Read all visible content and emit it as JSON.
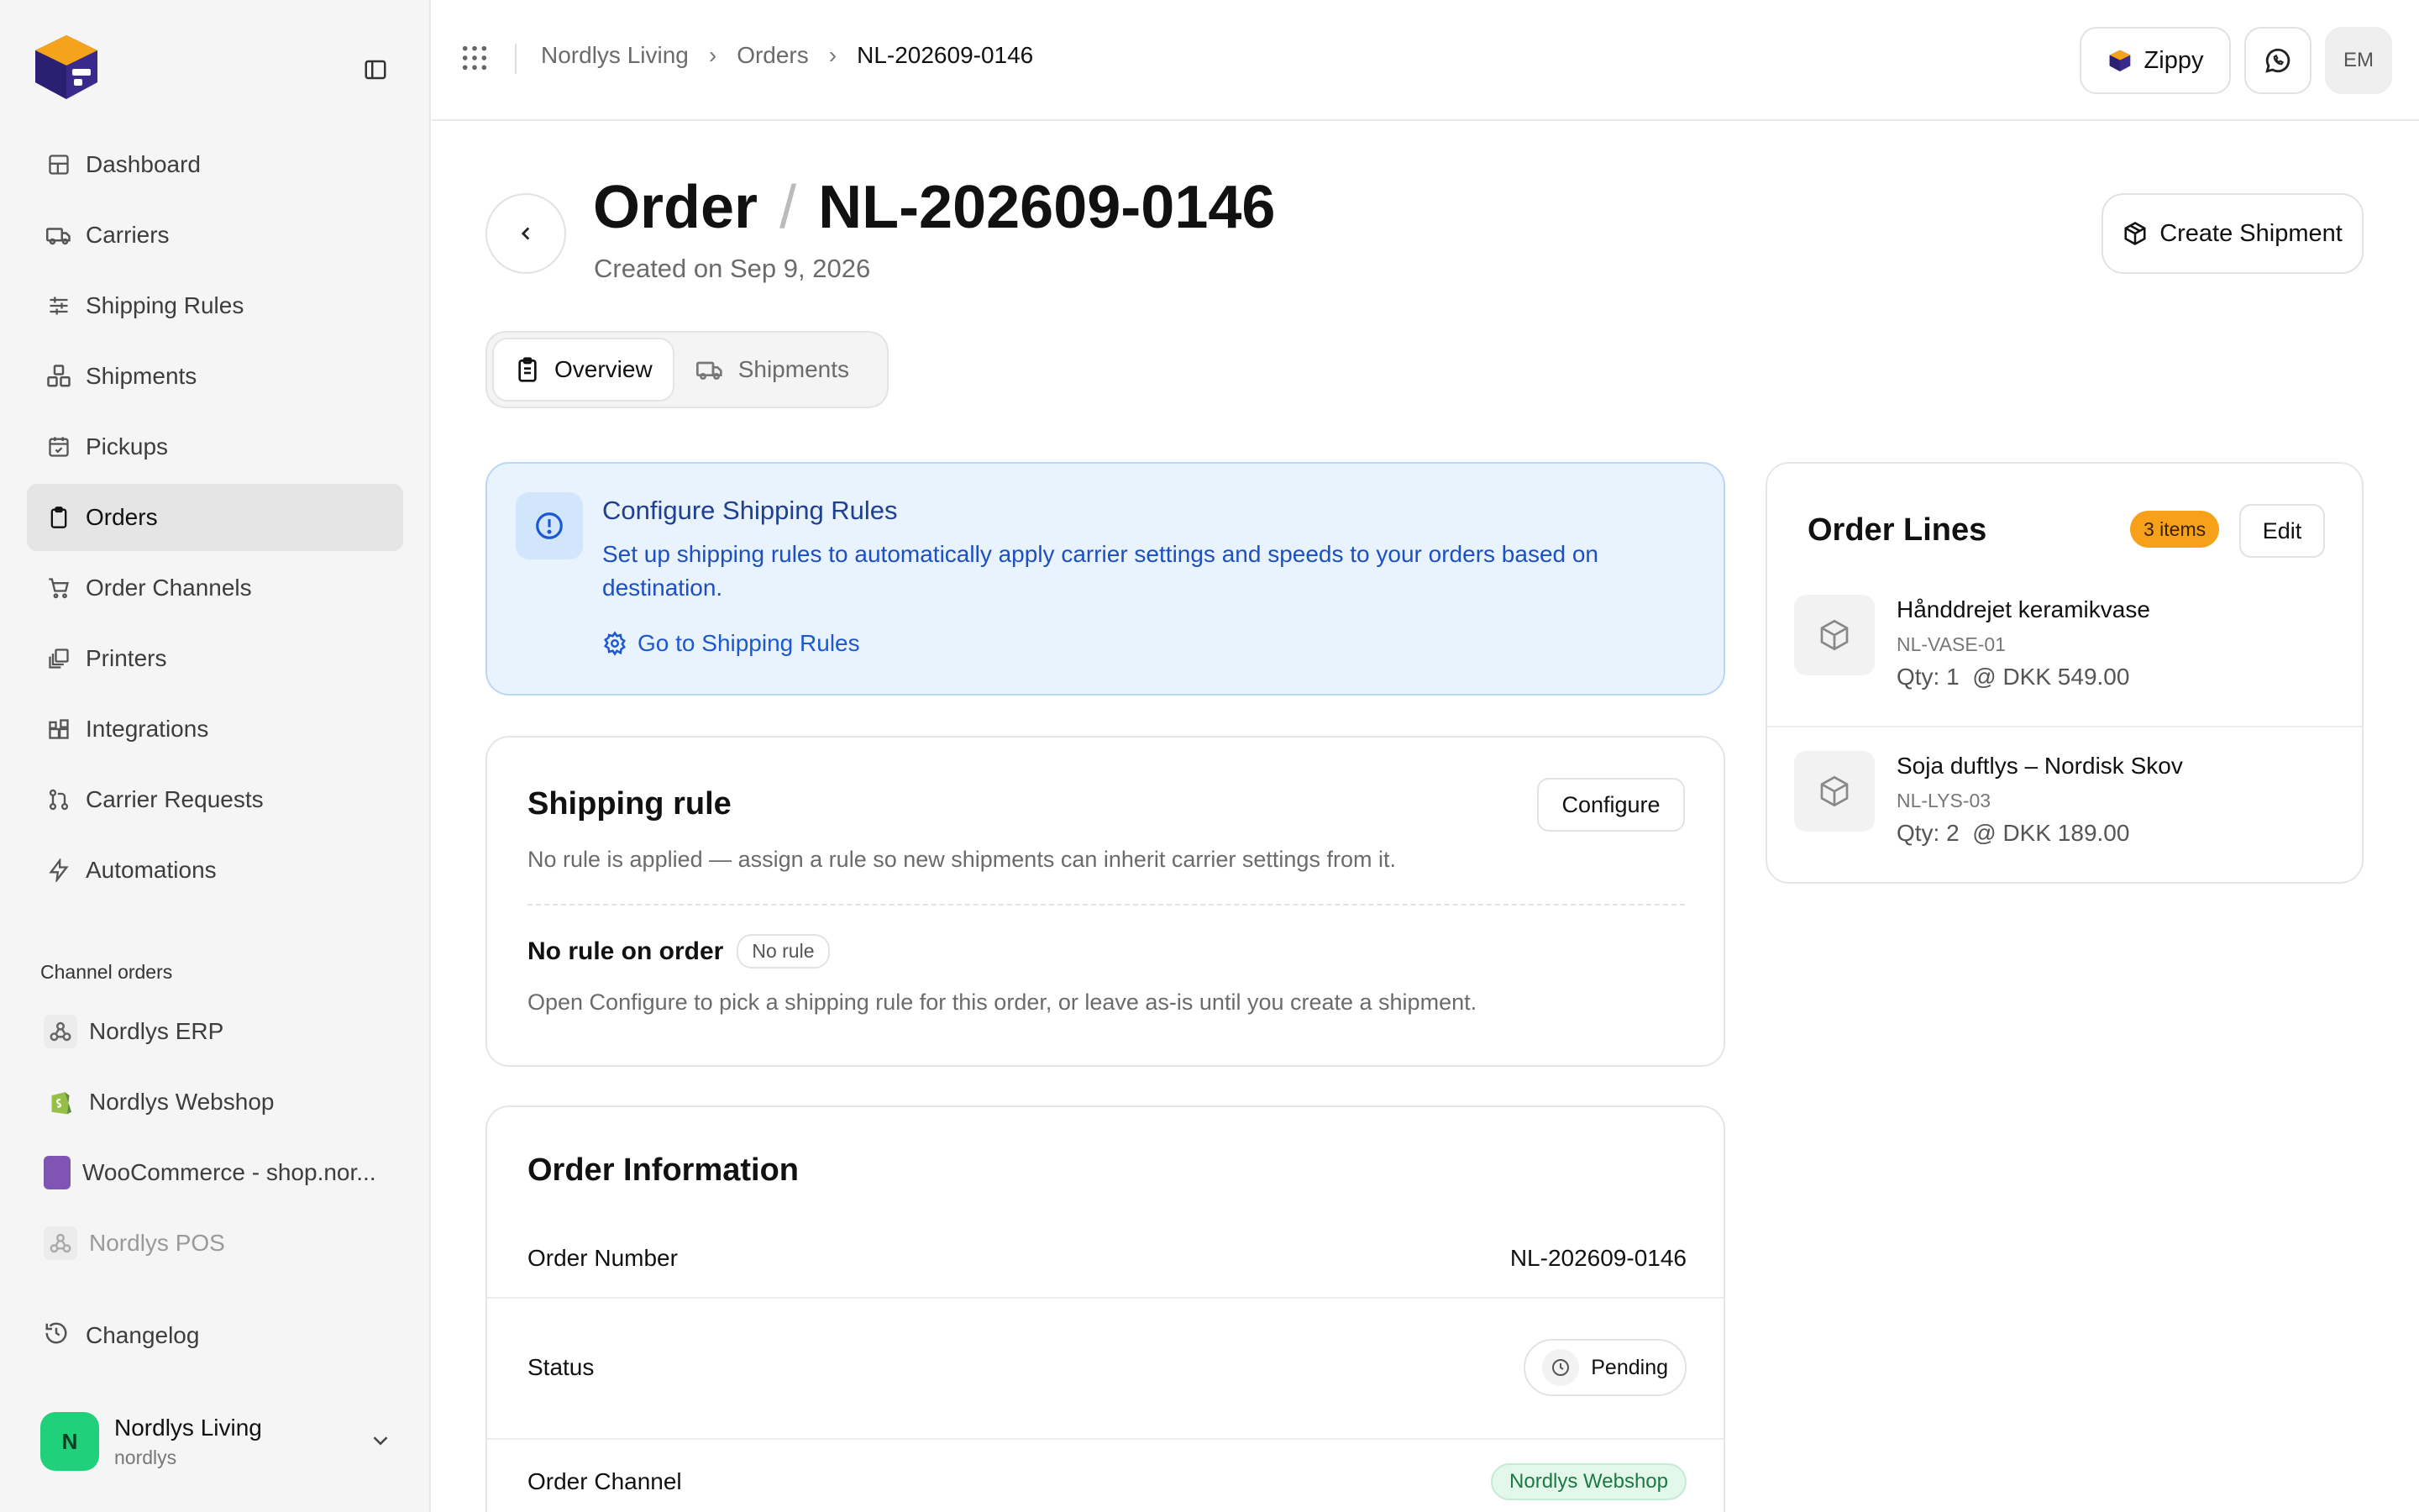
{
  "sidebar": {
    "nav": [
      {
        "label": "Dashboard",
        "icon": "dashboard-icon"
      },
      {
        "label": "Carriers",
        "icon": "truck-icon"
      },
      {
        "label": "Shipping Rules",
        "icon": "sliders-icon"
      },
      {
        "label": "Shipments",
        "icon": "boxes-icon"
      },
      {
        "label": "Pickups",
        "icon": "calendar-check-icon"
      },
      {
        "label": "Orders",
        "icon": "clipboard-icon",
        "active": true
      },
      {
        "label": "Order Channels",
        "icon": "cart-icon"
      },
      {
        "label": "Printers",
        "icon": "printer-icon"
      },
      {
        "label": "Integrations",
        "icon": "blocks-icon"
      },
      {
        "label": "Carrier Requests",
        "icon": "git-pull-icon"
      },
      {
        "label": "Automations",
        "icon": "lightning-icon"
      }
    ],
    "channels_label": "Channel orders",
    "channels": [
      {
        "label": "Nordlys ERP",
        "icon": "webhook-icon"
      },
      {
        "label": "Nordlys Webshop",
        "icon": "shopify-icon"
      },
      {
        "label": "WooCommerce - shop.nor...",
        "icon": "woocommerce-icon"
      },
      {
        "label": "Nordlys POS",
        "icon": "webhook-icon",
        "dim": true
      }
    ],
    "changelog": "Changelog",
    "user": {
      "initial": "N",
      "name": "Nordlys Living",
      "handle": "nordlys"
    }
  },
  "topbar": {
    "breadcrumbs": [
      "Nordlys Living",
      "Orders",
      "NL-202609-0146"
    ],
    "zippy_label": "Zippy",
    "avatar_initials": "EM"
  },
  "header": {
    "title_prefix": "Order",
    "title_id": "NL-202609-0146",
    "created": "Created on Sep 9, 2026",
    "create_shipment": "Create Shipment"
  },
  "tabs": [
    {
      "label": "Overview",
      "active": true
    },
    {
      "label": "Shipments",
      "active": false
    }
  ],
  "notice": {
    "title": "Configure Shipping Rules",
    "text": "Set up shipping rules to automatically apply carrier settings and speeds to your orders based on destination.",
    "link": "Go to Shipping Rules"
  },
  "shipping_rule": {
    "title": "Shipping rule",
    "configure": "Configure",
    "desc": "No rule is applied — assign a rule so new shipments can inherit carrier settings from it.",
    "status_title": "No rule on order",
    "status_badge": "No rule",
    "status_desc": "Open Configure to pick a shipping rule for this order, or leave as-is until you create a shipment."
  },
  "order_info": {
    "title": "Order Information",
    "order_number_label": "Order Number",
    "order_number": "NL-202609-0146",
    "status_label": "Status",
    "status": "Pending",
    "channel_label": "Order Channel",
    "channel": "Nordlys Webshop"
  },
  "order_lines": {
    "title": "Order Lines",
    "badge": "3 items",
    "edit": "Edit",
    "items": [
      {
        "name": "Hånddrejet keramikvase",
        "sku": "NL-VASE-01",
        "qty": "Qty: 1  @ DKK 549.00"
      },
      {
        "name": "Soja duftlys – Nordisk Skov",
        "sku": "NL-LYS-03",
        "qty": "Qty: 2  @ DKK 189.00"
      }
    ]
  },
  "colors": {
    "accent_blue": "#1c58d1",
    "badge_orange": "#f7a11a",
    "avatar_green": "#1fd17a",
    "channel_green": "#1a7a43"
  }
}
